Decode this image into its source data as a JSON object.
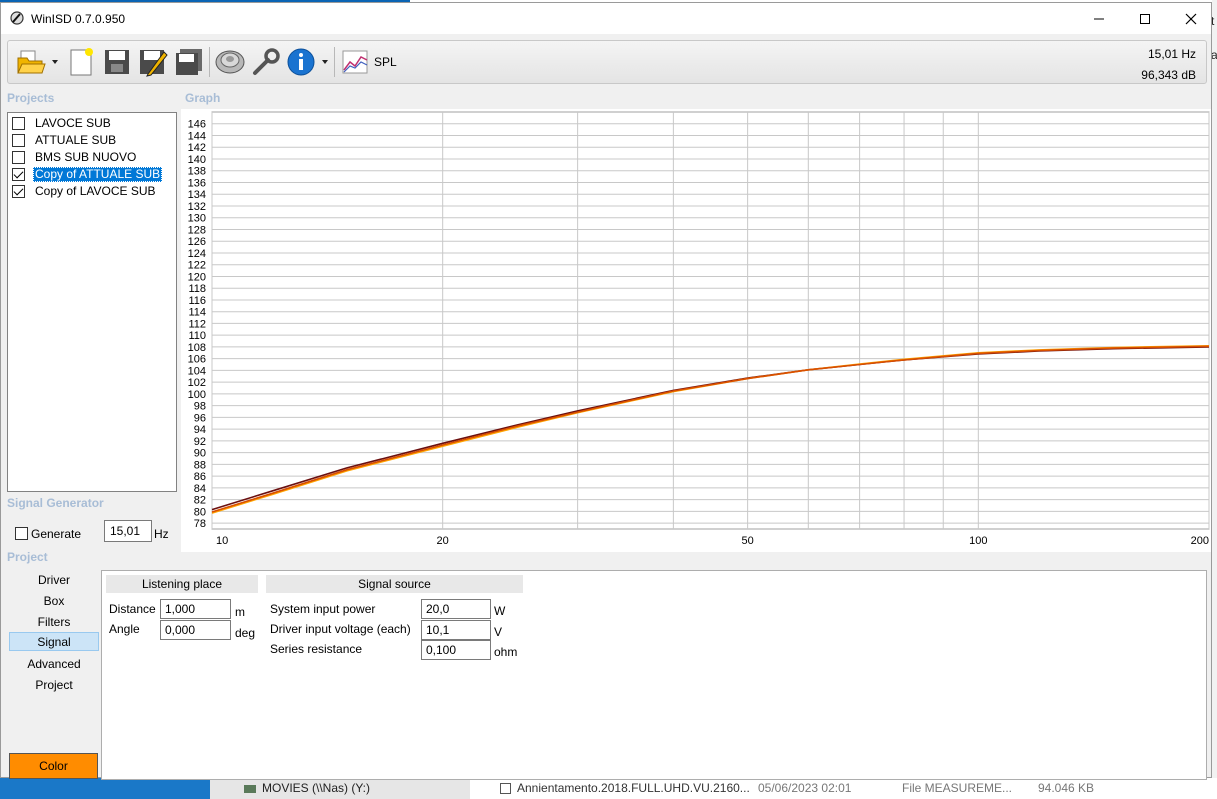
{
  "window": {
    "title": "WinISD 0.7.0.950"
  },
  "toolbar": {
    "spl_label": "SPL",
    "icons": [
      "open-folder-icon",
      "new-project-icon",
      "save-icon",
      "save-as-icon",
      "save-all-icon",
      "driver-icon",
      "tools-icon",
      "info-icon",
      "spl-graph-icon"
    ]
  },
  "readout": {
    "frequency": "15,01 Hz",
    "level": "96,343 dB"
  },
  "projects": {
    "label": "Projects",
    "items": [
      {
        "label": "LAVOCE SUB",
        "checked": false,
        "selected": false
      },
      {
        "label": "ATTUALE SUB",
        "checked": false,
        "selected": false
      },
      {
        "label": "BMS SUB NUOVO",
        "checked": false,
        "selected": false
      },
      {
        "label": "Copy of ATTUALE SUB",
        "checked": true,
        "selected": true
      },
      {
        "label": "Copy of LAVOCE SUB",
        "checked": true,
        "selected": false
      }
    ]
  },
  "graph": {
    "label": "Graph"
  },
  "chart_data": {
    "type": "line",
    "xscale": "log",
    "xlim": [
      10,
      200
    ],
    "ylim": [
      77,
      148
    ],
    "xticks": [
      10,
      20,
      50,
      100,
      200
    ],
    "xtick_labels": [
      "10",
      "20",
      "50",
      "100",
      "200"
    ],
    "yticks": [
      78,
      80,
      82,
      84,
      86,
      88,
      90,
      92,
      94,
      96,
      98,
      100,
      102,
      104,
      106,
      108,
      110,
      112,
      114,
      116,
      118,
      120,
      122,
      124,
      126,
      128,
      130,
      132,
      134,
      136,
      138,
      140,
      142,
      144,
      146
    ],
    "grid": true,
    "series": [
      {
        "color": "#6b1010",
        "x": [
          10,
          12,
          15,
          20,
          25,
          30,
          40,
          50,
          60,
          70,
          80,
          100,
          120,
          150,
          200
        ],
        "y": [
          80.3,
          83.5,
          87.4,
          91.6,
          94.7,
          97.1,
          100.6,
          102.7,
          104.1,
          105.0,
          105.8,
          106.8,
          107.3,
          107.7,
          108.0
        ]
      },
      {
        "color": "#ffa500",
        "x": [
          10,
          12,
          15,
          20,
          25,
          30,
          40,
          50,
          60,
          70,
          80,
          100,
          120,
          150,
          200
        ],
        "y": [
          79.7,
          82.9,
          86.9,
          91.1,
          94.3,
          96.8,
          100.4,
          102.6,
          104.1,
          105.1,
          105.9,
          107.0,
          107.5,
          107.9,
          108.2
        ]
      },
      {
        "color": "#d94f00",
        "x": [
          10,
          12,
          15,
          20,
          25,
          30,
          40,
          50,
          60,
          70,
          80,
          100,
          120,
          150,
          200
        ],
        "y": [
          79.9,
          83.1,
          87.1,
          91.3,
          94.5,
          96.9,
          100.5,
          102.6,
          104.1,
          105.0,
          105.8,
          106.9,
          107.4,
          107.8,
          108.1
        ]
      }
    ]
  },
  "signal_generator": {
    "label": "Signal Generator",
    "generate_label": "Generate",
    "value": "15,01",
    "unit": "Hz"
  },
  "project": {
    "label": "Project",
    "tabs": [
      "Driver",
      "Box",
      "Filters",
      "Signal",
      "Advanced",
      "Project"
    ],
    "active_tab": "Signal",
    "color_button": "Color"
  },
  "signal_panel": {
    "listening": {
      "title": "Listening place",
      "distance_label": "Distance",
      "distance_value": "1,000",
      "distance_unit": "m",
      "angle_label": "Angle",
      "angle_value": "0,000",
      "angle_unit": "deg"
    },
    "source": {
      "title": "Signal source",
      "power_label": "System input power",
      "power_value": "20,0",
      "power_unit": "W",
      "voltage_label": "Driver input voltage (each)",
      "voltage_value": "10,1",
      "voltage_unit": "V",
      "resistance_label": "Series resistance",
      "resistance_value": "0,100",
      "resistance_unit": "ohm"
    }
  },
  "background": {
    "drive_label": "MOVIES (\\\\Nas) (Y:)",
    "file_name": "Annientamento.2018.FULL.UHD.VU.2160...",
    "file_date": "05/06/2023 02:01",
    "file_type": "File MEASUREME...",
    "file_size": "94.046 KB",
    "edge_chars": [
      "t",
      "a"
    ]
  }
}
